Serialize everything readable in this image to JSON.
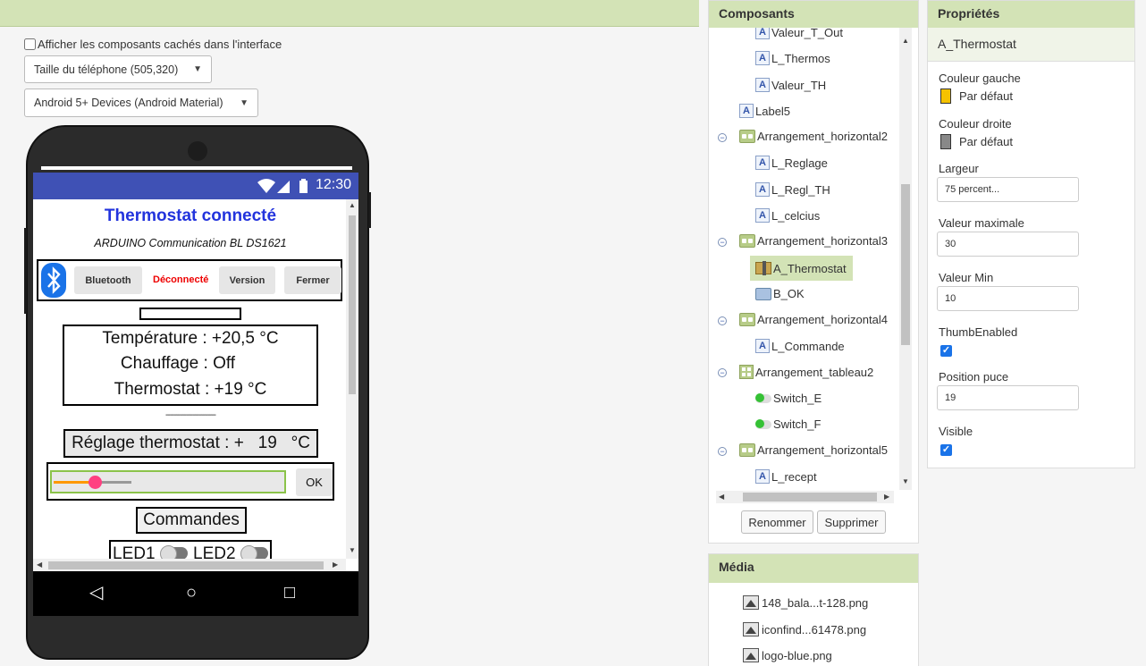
{
  "viewer": {
    "hidden_components_label": "Afficher les composants cachés dans l'interface",
    "phone_size": "Taille du téléphone (505,320)",
    "theme": "Android 5+ Devices (Android Material)"
  },
  "phone": {
    "time": "12:30",
    "title": "Thermostat connecté",
    "subtitle": "ARDUINO Communication BL DS1621",
    "buttons": [
      "Bluetooth",
      "Version",
      "Fermer"
    ],
    "status": "Déconnecté",
    "temperature": "Température : +20,5 °C",
    "chauffage": "Chauffage : Off",
    "thermostat": "Thermostat : +19 °C",
    "dashes": "------------------------",
    "reglage": "Réglage thermostat : +   19   °C",
    "ok_label": "OK",
    "commandes": "Commandes",
    "led1": "LED1",
    "led2": "LED2",
    "slider_level": 0.19
  },
  "components": {
    "title": "Composants",
    "items": [
      {
        "label": "Valeur_T_Out",
        "icon": "label-icon"
      },
      {
        "label": "L_Thermos",
        "icon": "label-icon"
      },
      {
        "label": "Valeur_TH",
        "icon": "label-icon"
      },
      {
        "label": "Label5",
        "icon": "label-icon"
      },
      {
        "label": "Arrangement_horizontal2",
        "icon": "horizontal-arrangement-icon"
      },
      {
        "label": "L_Reglage",
        "icon": "label-icon"
      },
      {
        "label": "L_Regl_TH",
        "icon": "label-icon"
      },
      {
        "label": "L_celcius",
        "icon": "label-icon"
      },
      {
        "label": "Arrangement_horizontal3",
        "icon": "horizontal-arrangement-icon"
      },
      {
        "label": "A_Thermostat",
        "icon": "slider-icon"
      },
      {
        "label": "B_OK",
        "icon": "button-icon"
      },
      {
        "label": "Arrangement_horizontal4",
        "icon": "horizontal-arrangement-icon"
      },
      {
        "label": "L_Commande",
        "icon": "label-icon"
      },
      {
        "label": "Arrangement_tableau2",
        "icon": "table-arrangement-icon"
      },
      {
        "label": "Switch_E",
        "icon": "switch-icon"
      },
      {
        "label": "Switch_F",
        "icon": "switch-icon"
      },
      {
        "label": "Arrangement_horizontal5",
        "icon": "horizontal-arrangement-icon"
      },
      {
        "label": "L_recept",
        "icon": "label-icon"
      }
    ],
    "rename_label": "Renommer",
    "delete_label": "Supprimer"
  },
  "media": {
    "title": "Média",
    "items": [
      "148_bala...t-128.png",
      "iconfind...61478.png",
      "logo-blue.png"
    ]
  },
  "properties": {
    "title": "Propriétés",
    "component": "A_Thermostat",
    "couleur_gauche_label": "Couleur gauche",
    "couleur_gauche_value": "Par défaut",
    "couleur_gauche_color": "#f5c200",
    "couleur_droite_label": "Couleur droite",
    "couleur_droite_value": "Par défaut",
    "couleur_droite_color": "#888888",
    "largeur_label": "Largeur",
    "largeur_value": "75 percent...",
    "valeur_max_label": "Valeur maximale",
    "valeur_max_value": "30",
    "valeur_min_label": "Valeur Min",
    "valeur_min_value": "10",
    "thumb_label": "ThumbEnabled",
    "thumb_checked": true,
    "position_label": "Position puce",
    "position_value": "19",
    "visible_label": "Visible",
    "visible_checked": true
  },
  "colors": {
    "header_green": "#d3e3b6",
    "status_bar": "#3f51b5",
    "title_blue": "#2233dd",
    "slider_fill": "#ff9800",
    "slider_thumb": "#ff4081"
  }
}
